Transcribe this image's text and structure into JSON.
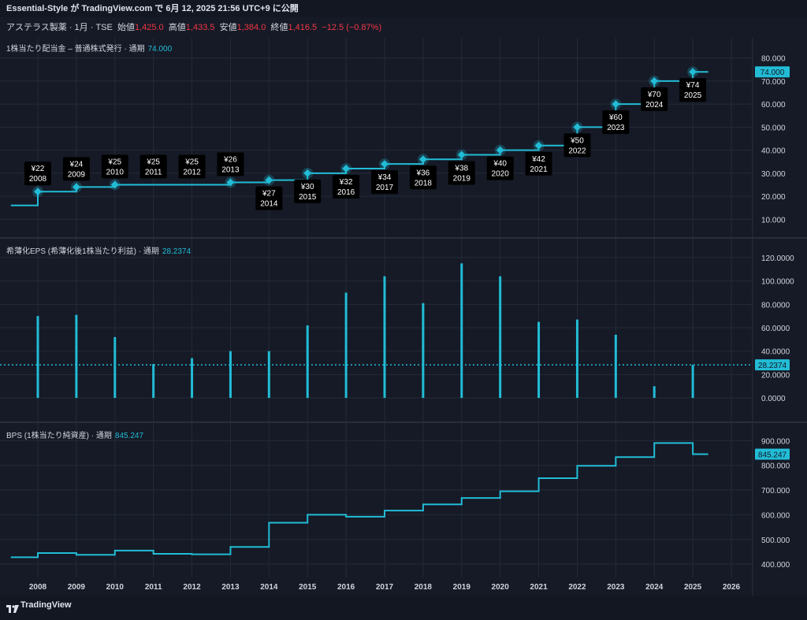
{
  "header": {
    "published": "Essential-Style が TradingView.com で 6月 12, 2025 21:56 UTC+9 に公開"
  },
  "symbol": {
    "name": "アステラス製薬 · 1月 · TSE",
    "open_label": "始値",
    "open": "1,425.0",
    "high_label": "高値",
    "high": "1,433.5",
    "low_label": "安値",
    "low": "1,384.0",
    "close_label": "終値",
    "close": "1,416.5",
    "change": "−12.5 (−0.87%)"
  },
  "panes": {
    "dividend": {
      "label": "1株当たり配当金 – 普通株式発行 · 通期",
      "value": "74.000"
    },
    "eps": {
      "label": "希薄化EPS (希薄化後1株当たり利益) · 通期",
      "value": "28.2374"
    },
    "bps": {
      "label": "BPS (1株当たり純資産) · 通期",
      "value": "845.247"
    }
  },
  "footer": {
    "brand": "TradingView"
  },
  "colors": {
    "series": "#22bcd6",
    "background": "#131722",
    "grid": "#242a38",
    "marker_label_bg": "#000000"
  },
  "chart_data": [
    {
      "type": "line",
      "step": true,
      "title": "1株当たり配当金 – 普通株式発行 · 通期",
      "ylim": [
        6,
        84
      ],
      "yticks": [
        "80.000",
        "70.000",
        "60.000",
        "50.000",
        "40.000",
        "30.000",
        "20.000",
        "10.000"
      ],
      "ytick_values": [
        80,
        70,
        60,
        50,
        40,
        30,
        20,
        10
      ],
      "last_value_label": "74.000",
      "x": [
        2007.3,
        2008,
        2009,
        2010,
        2011,
        2012,
        2013,
        2014,
        2015,
        2016,
        2017,
        2018,
        2019,
        2020,
        2021,
        2022,
        2023,
        2024,
        2025,
        2025.4
      ],
      "values": [
        16,
        22,
        24,
        25,
        25,
        25,
        26,
        27,
        30,
        32,
        34,
        36,
        38,
        40,
        42,
        50,
        60,
        70,
        74,
        74
      ],
      "markers": [
        {
          "x": 2008,
          "y": 22,
          "label": "¥22",
          "year": "2008",
          "pos": "above"
        },
        {
          "x": 2009,
          "y": 24,
          "label": "¥24",
          "year": "2009",
          "pos": "above"
        },
        {
          "x": 2010,
          "y": 25,
          "label": "¥25",
          "year": "2010",
          "pos": "above"
        },
        {
          "x": 2011,
          "y": 25,
          "label": "¥25",
          "year": "2011",
          "pos": "above",
          "hidden_point": true
        },
        {
          "x": 2012,
          "y": 25,
          "label": "¥25",
          "year": "2012",
          "pos": "above",
          "hidden_point": true
        },
        {
          "x": 2013,
          "y": 26,
          "label": "¥26",
          "year": "2013",
          "pos": "above"
        },
        {
          "x": 2014,
          "y": 27,
          "label": "¥27",
          "year": "2014",
          "pos": "below"
        },
        {
          "x": 2015,
          "y": 30,
          "label": "¥30",
          "year": "2015",
          "pos": "below"
        },
        {
          "x": 2016,
          "y": 32,
          "label": "¥32",
          "year": "2016",
          "pos": "below"
        },
        {
          "x": 2017,
          "y": 34,
          "label": "¥34",
          "year": "2017",
          "pos": "below"
        },
        {
          "x": 2018,
          "y": 36,
          "label": "¥36",
          "year": "2018",
          "pos": "below"
        },
        {
          "x": 2019,
          "y": 38,
          "label": "¥38",
          "year": "2019",
          "pos": "below"
        },
        {
          "x": 2020,
          "y": 40,
          "label": "¥40",
          "year": "2020",
          "pos": "below"
        },
        {
          "x": 2021,
          "y": 42,
          "label": "¥42",
          "year": "2021",
          "pos": "below"
        },
        {
          "x": 2022,
          "y": 50,
          "label": "¥50",
          "year": "2022",
          "pos": "below"
        },
        {
          "x": 2023,
          "y": 60,
          "label": "¥60",
          "year": "2023",
          "pos": "below"
        },
        {
          "x": 2024,
          "y": 70,
          "label": "¥70",
          "year": "2024",
          "pos": "below"
        },
        {
          "x": 2025,
          "y": 74,
          "label": "¥74",
          "year": "2025",
          "pos": "below"
        }
      ]
    },
    {
      "type": "bar",
      "title": "希薄化EPS (希薄化後1株当たり利益) · 通期",
      "ylim": [
        -8,
        126
      ],
      "yticks": [
        "120.0000",
        "100.0000",
        "80.0000",
        "60.0000",
        "40.0000",
        "20.0000",
        "0.0000"
      ],
      "ytick_values": [
        120,
        100,
        80,
        60,
        40,
        20,
        0
      ],
      "last_value_label": "28.2374",
      "reference_line": 28.2374,
      "x": [
        2008,
        2009,
        2010,
        2011,
        2012,
        2013,
        2014,
        2015,
        2016,
        2017,
        2018,
        2019,
        2020,
        2021,
        2022,
        2023,
        2024,
        2025
      ],
      "values": [
        70,
        71,
        52,
        29,
        34,
        40,
        40,
        62,
        90,
        104,
        81,
        115,
        104,
        65,
        67,
        54,
        10,
        28.2374
      ]
    },
    {
      "type": "line",
      "step": true,
      "title": "BPS (1株当たり純資産) · 通期",
      "ylim": [
        375,
        920
      ],
      "yticks": [
        "900.000",
        "800.000",
        "700.000",
        "600.000",
        "500.000",
        "400.000"
      ],
      "ytick_values": [
        900,
        800,
        700,
        600,
        500,
        400
      ],
      "last_value_label": "845.247",
      "x": [
        2007.3,
        2008,
        2009,
        2010,
        2011,
        2012,
        2013,
        2014,
        2015,
        2016,
        2017,
        2018,
        2019,
        2020,
        2021,
        2022,
        2023,
        2024,
        2025,
        2025.4
      ],
      "values": [
        428,
        445,
        438,
        455,
        442,
        440,
        470,
        568,
        600,
        592,
        617,
        642,
        668,
        695,
        748,
        798,
        833,
        890,
        845.247,
        845.247
      ]
    }
  ],
  "xaxis": {
    "ticks": [
      "2008",
      "2009",
      "2010",
      "2011",
      "2012",
      "2013",
      "2014",
      "2015",
      "2016",
      "2017",
      "2018",
      "2019",
      "2020",
      "2021",
      "2022",
      "2023",
      "2024",
      "2025",
      "2026"
    ],
    "tick_values": [
      2008,
      2009,
      2010,
      2011,
      2012,
      2013,
      2014,
      2015,
      2016,
      2017,
      2018,
      2019,
      2020,
      2021,
      2022,
      2023,
      2024,
      2025,
      2026
    ]
  }
}
